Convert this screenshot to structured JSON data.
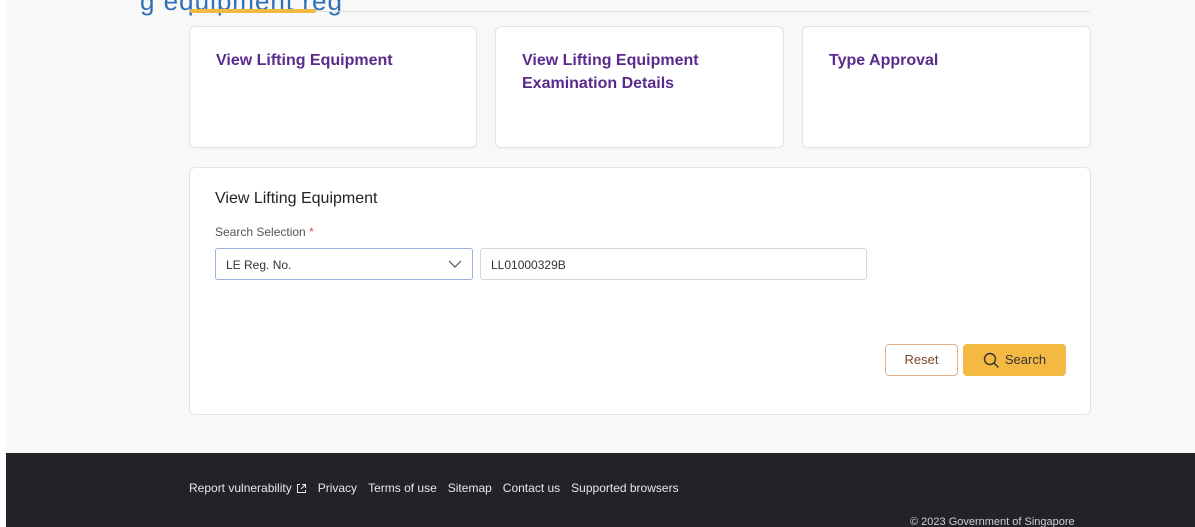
{
  "header": {
    "title_fragment": "g equipment reg"
  },
  "cards": [
    {
      "label": "View Lifting Equipment"
    },
    {
      "label": "View Lifting Equipment\nExamination Details"
    },
    {
      "label": "Type Approval"
    }
  ],
  "panel": {
    "title": "View Lifting Equipment",
    "search_label": "Search Selection",
    "required_mark": "*",
    "select_value": "LE Reg. No.",
    "input_value": "LL01000329B",
    "reset_label": "Reset",
    "search_label_btn": "Search"
  },
  "footer": {
    "links": [
      "Report vulnerability",
      "Privacy",
      "Terms of use",
      "Sitemap",
      "Contact us",
      "Supported browsers"
    ],
    "copyright": "© 2023 Government of Singapore"
  },
  "colors": {
    "accent": "#f4b942",
    "link_purple": "#5a2b8c",
    "footer_bg": "#212327"
  }
}
